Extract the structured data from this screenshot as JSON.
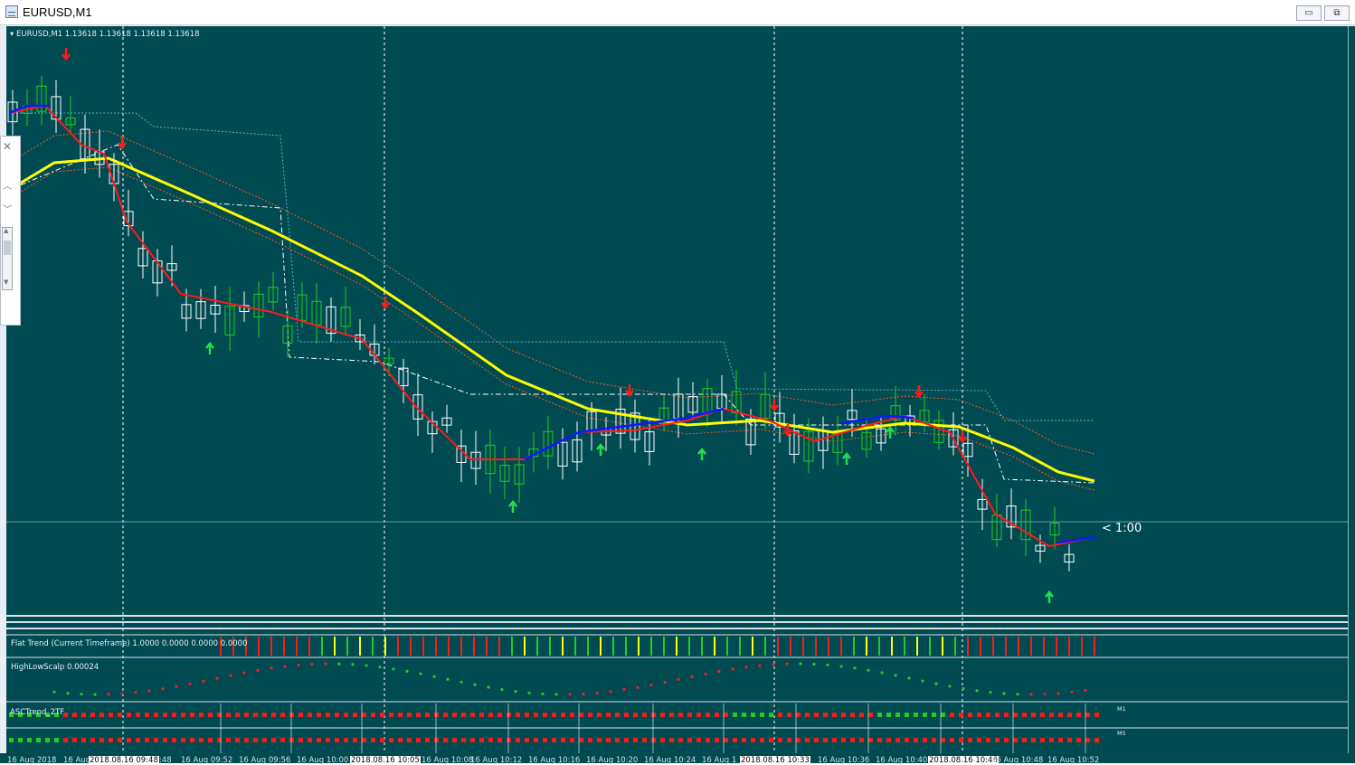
{
  "window": {
    "title": "EURUSD,M1",
    "buttons": {
      "minimize": "▭",
      "maximize": "⧉",
      "close": "✕"
    }
  },
  "chart": {
    "header": "EURUSD,M1  1.13618 1.13618 1.13618 1.13618",
    "countdown": "< 1:00",
    "colors": {
      "background": "#004a52",
      "bull_candle": "#22cc22",
      "bear_candle": "#ffffff",
      "fast_ma_down": "#ff1a1a",
      "fast_ma_up": "#0a1aff",
      "slow_ma": "#ffff00",
      "envelope": "#ff5a14",
      "arrow_up": "#22e04a",
      "arrow_down": "#ff1a1a"
    }
  },
  "indicators": {
    "flat_trend": {
      "label": "Flat Trend (Current Timeframe) 1.0000 0.0000 0.0000 0.0000"
    },
    "high_low_scalp": {
      "label": "HighLowScalp 0.00024"
    },
    "asc_trend": {
      "label": "ASCTrend_2TF",
      "row1": "M1",
      "row2": "M5"
    }
  },
  "time_axis": {
    "ticks": [
      "16 Aug 2018",
      "16 Aug",
      "2018.08.16 09:48",
      ":48",
      "16 Aug 09:52",
      "16 Aug 09:56",
      "16 Aug 10:00",
      "2018.08.16 10:05",
      "16 Aug 10:08",
      "16 Aug 10:12",
      "16 Aug 10:16",
      "16 Aug 10:20",
      "16 Aug 10:24",
      "16 Aug 1",
      "2018.08.16 10:33",
      "16 Aug 10:36",
      "16 Aug 10:40",
      "2018.08.16 10:46",
      "16 Aug 10:48",
      "16 Aug 10:52"
    ]
  },
  "side_panel": {
    "close": "✕",
    "up": "︿",
    "down": "﹀",
    "scroll_up": "▲",
    "scroll_down": "▼"
  }
}
